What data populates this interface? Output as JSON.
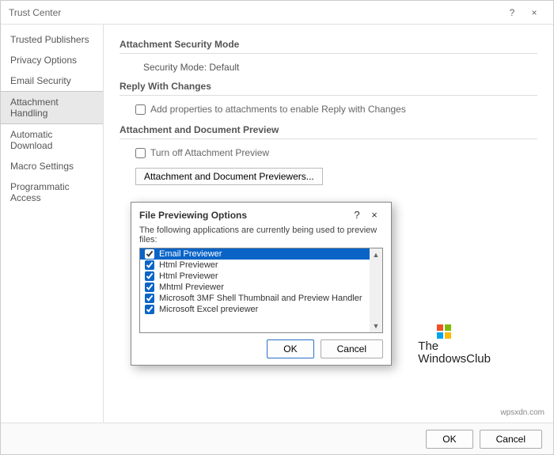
{
  "window": {
    "title": "Trust Center",
    "help_label": "?",
    "close_label": "×"
  },
  "sidebar": {
    "items": [
      {
        "label": "Trusted Publishers",
        "selected": false
      },
      {
        "label": "Privacy Options",
        "selected": false
      },
      {
        "label": "Email Security",
        "selected": false
      },
      {
        "label": "Attachment Handling",
        "selected": true
      },
      {
        "label": "Automatic Download",
        "selected": false
      },
      {
        "label": "Macro Settings",
        "selected": false
      },
      {
        "label": "Programmatic Access",
        "selected": false
      }
    ]
  },
  "sections": {
    "attachment_security": {
      "heading": "Attachment Security Mode",
      "value": "Security Mode: Default"
    },
    "reply_with_changes": {
      "heading": "Reply With Changes",
      "checkbox_label": "Add properties to attachments to enable Reply with Changes"
    },
    "attachment_preview": {
      "heading": "Attachment and Document Preview",
      "checkbox_label": "Turn off Attachment Preview",
      "button_label": "Attachment and Document Previewers..."
    }
  },
  "modal": {
    "title": "File Previewing Options",
    "help_label": "?",
    "close_label": "×",
    "description": "The following applications are currently being used to preview files:",
    "items": [
      {
        "label": "Email Previewer",
        "checked": true,
        "selected": true
      },
      {
        "label": "Html Previewer",
        "checked": true,
        "selected": false
      },
      {
        "label": "Html Previewer",
        "checked": true,
        "selected": false
      },
      {
        "label": "Mhtml Previewer",
        "checked": true,
        "selected": false
      },
      {
        "label": "Microsoft 3MF Shell Thumbnail and Preview Handler",
        "checked": true,
        "selected": false
      },
      {
        "label": "Microsoft Excel previewer",
        "checked": true,
        "selected": false
      }
    ],
    "ok_label": "OK",
    "cancel_label": "Cancel"
  },
  "footer": {
    "ok_label": "OK",
    "cancel_label": "Cancel"
  },
  "watermark": {
    "brand1": "The",
    "brand2": "WindowsClub",
    "site": "wpsxdn.com"
  }
}
